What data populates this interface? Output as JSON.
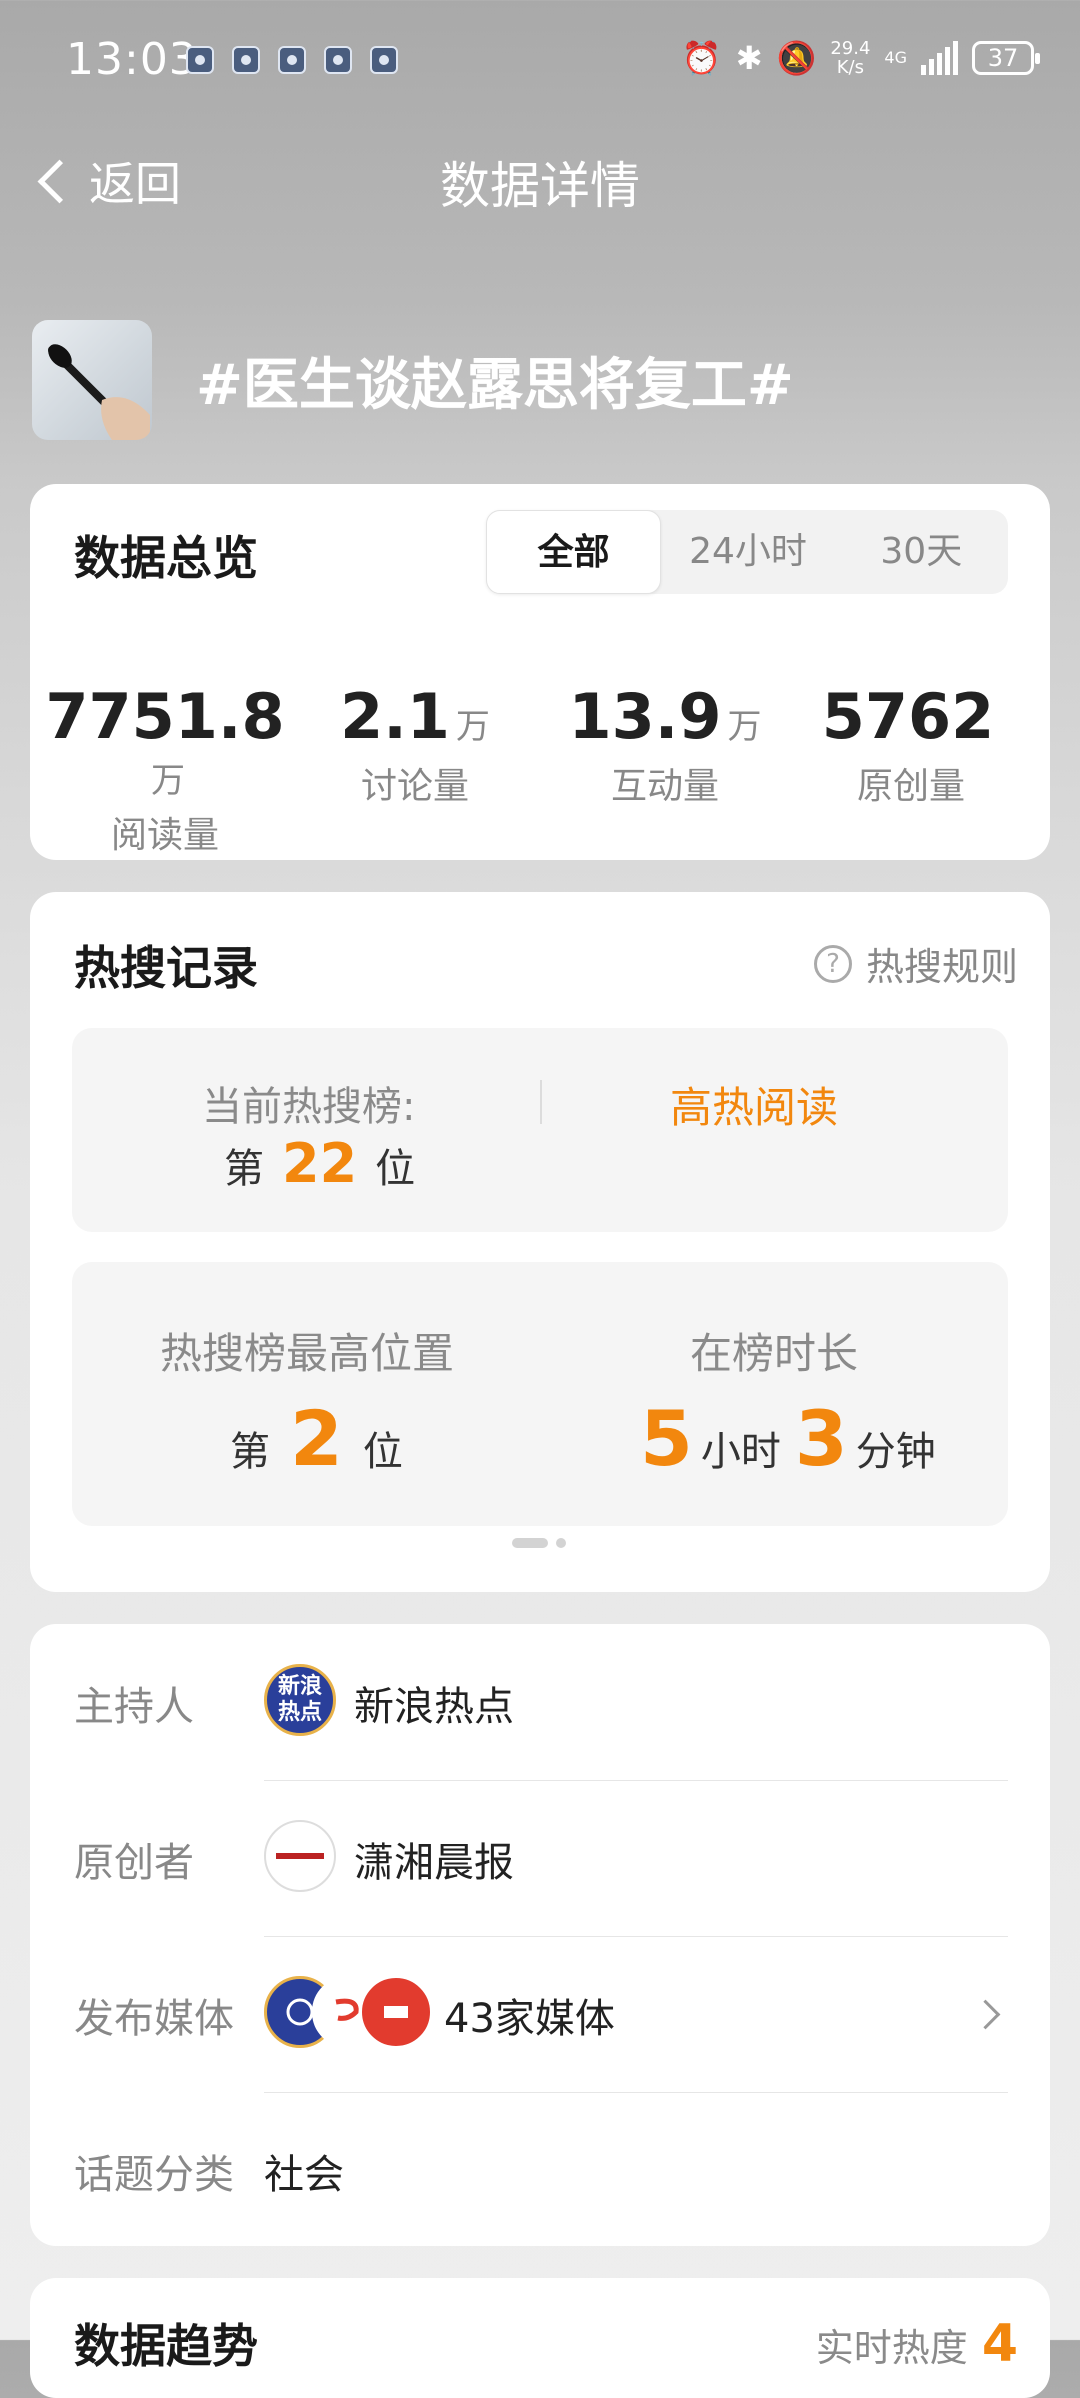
{
  "status_bar": {
    "time": "13:03",
    "speed": "29.4\nK/s",
    "network": "4G",
    "battery": "37",
    "icons": [
      "alarm-icon",
      "bluetooth-icon",
      "mute-icon",
      "signal-icon",
      "battery-icon"
    ]
  },
  "nav": {
    "back_label": "返回",
    "title": "数据详情"
  },
  "topic": {
    "title": "#医生谈赵露思将复工#"
  },
  "overview": {
    "title": "数据总览",
    "tabs": [
      "全部",
      "24小时",
      "30天"
    ],
    "active_tab": "全部",
    "stats": [
      {
        "value": "7751.8",
        "unit": "万",
        "label": "阅读量"
      },
      {
        "value": "2.1",
        "unit": "万",
        "label": "讨论量"
      },
      {
        "value": "13.9",
        "unit": "万",
        "label": "互动量"
      },
      {
        "value": "5762",
        "unit": "",
        "label": "原创量"
      }
    ]
  },
  "hot_search": {
    "title": "热搜记录",
    "rules_label": "热搜规则",
    "current_label": "当前热搜榜:",
    "rank_prefix": "第",
    "current_rank": "22",
    "rank_suffix": "位",
    "tag": "高热阅读",
    "highest_label": "热搜榜最高位置",
    "highest_rank": "2",
    "duration_label": "在榜时长",
    "hours": "5",
    "hours_unit": "小时",
    "minutes": "3",
    "minutes_unit": "分钟"
  },
  "info": {
    "host_label": "主持人",
    "host_name": "新浪热点",
    "host_avatar_text": "新浪热点",
    "creator_label": "原创者",
    "creator_name": "潇湘晨报",
    "media_label": "发布媒体",
    "media_count": "43家媒体",
    "category_label": "话题分类",
    "category_value": "社会"
  },
  "trend": {
    "title": "数据趋势",
    "realtime_label": "实时热度",
    "realtime_value": "4"
  },
  "colors": {
    "accent_orange": "#f2870e",
    "card_bg": "#ffffff"
  }
}
